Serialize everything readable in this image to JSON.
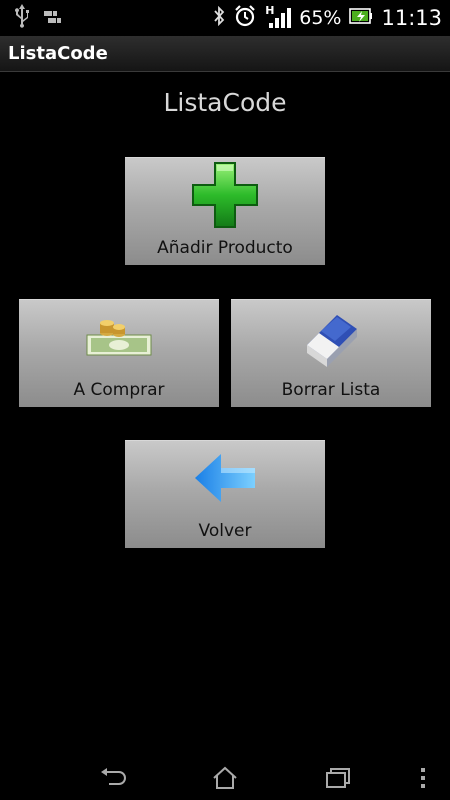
{
  "status_bar": {
    "battery_percent": "65%",
    "time": "11:13",
    "network_type": "H",
    "icons": [
      "usb-icon",
      "download-icon",
      "bluetooth-icon",
      "alarm-icon",
      "signal-icon",
      "battery-icon"
    ]
  },
  "title_bar": {
    "title": "ListaCode"
  },
  "main": {
    "heading": "ListaCode",
    "buttons": [
      {
        "label": "Añadir Producto",
        "icon": "plus-icon"
      },
      {
        "label": "A Comprar",
        "icon": "money-icon"
      },
      {
        "label": "Borrar Lista",
        "icon": "eraser-icon"
      },
      {
        "label": "Volver",
        "icon": "back-arrow-icon"
      }
    ]
  },
  "nav_bar": {
    "icons": [
      "back-icon",
      "home-icon",
      "recent-apps-icon",
      "menu-icon"
    ]
  },
  "colors": {
    "background": "#000000",
    "tile": "#a9a9a9",
    "plus_green": "#22b52a",
    "arrow_blue": "#1e8fe0"
  }
}
